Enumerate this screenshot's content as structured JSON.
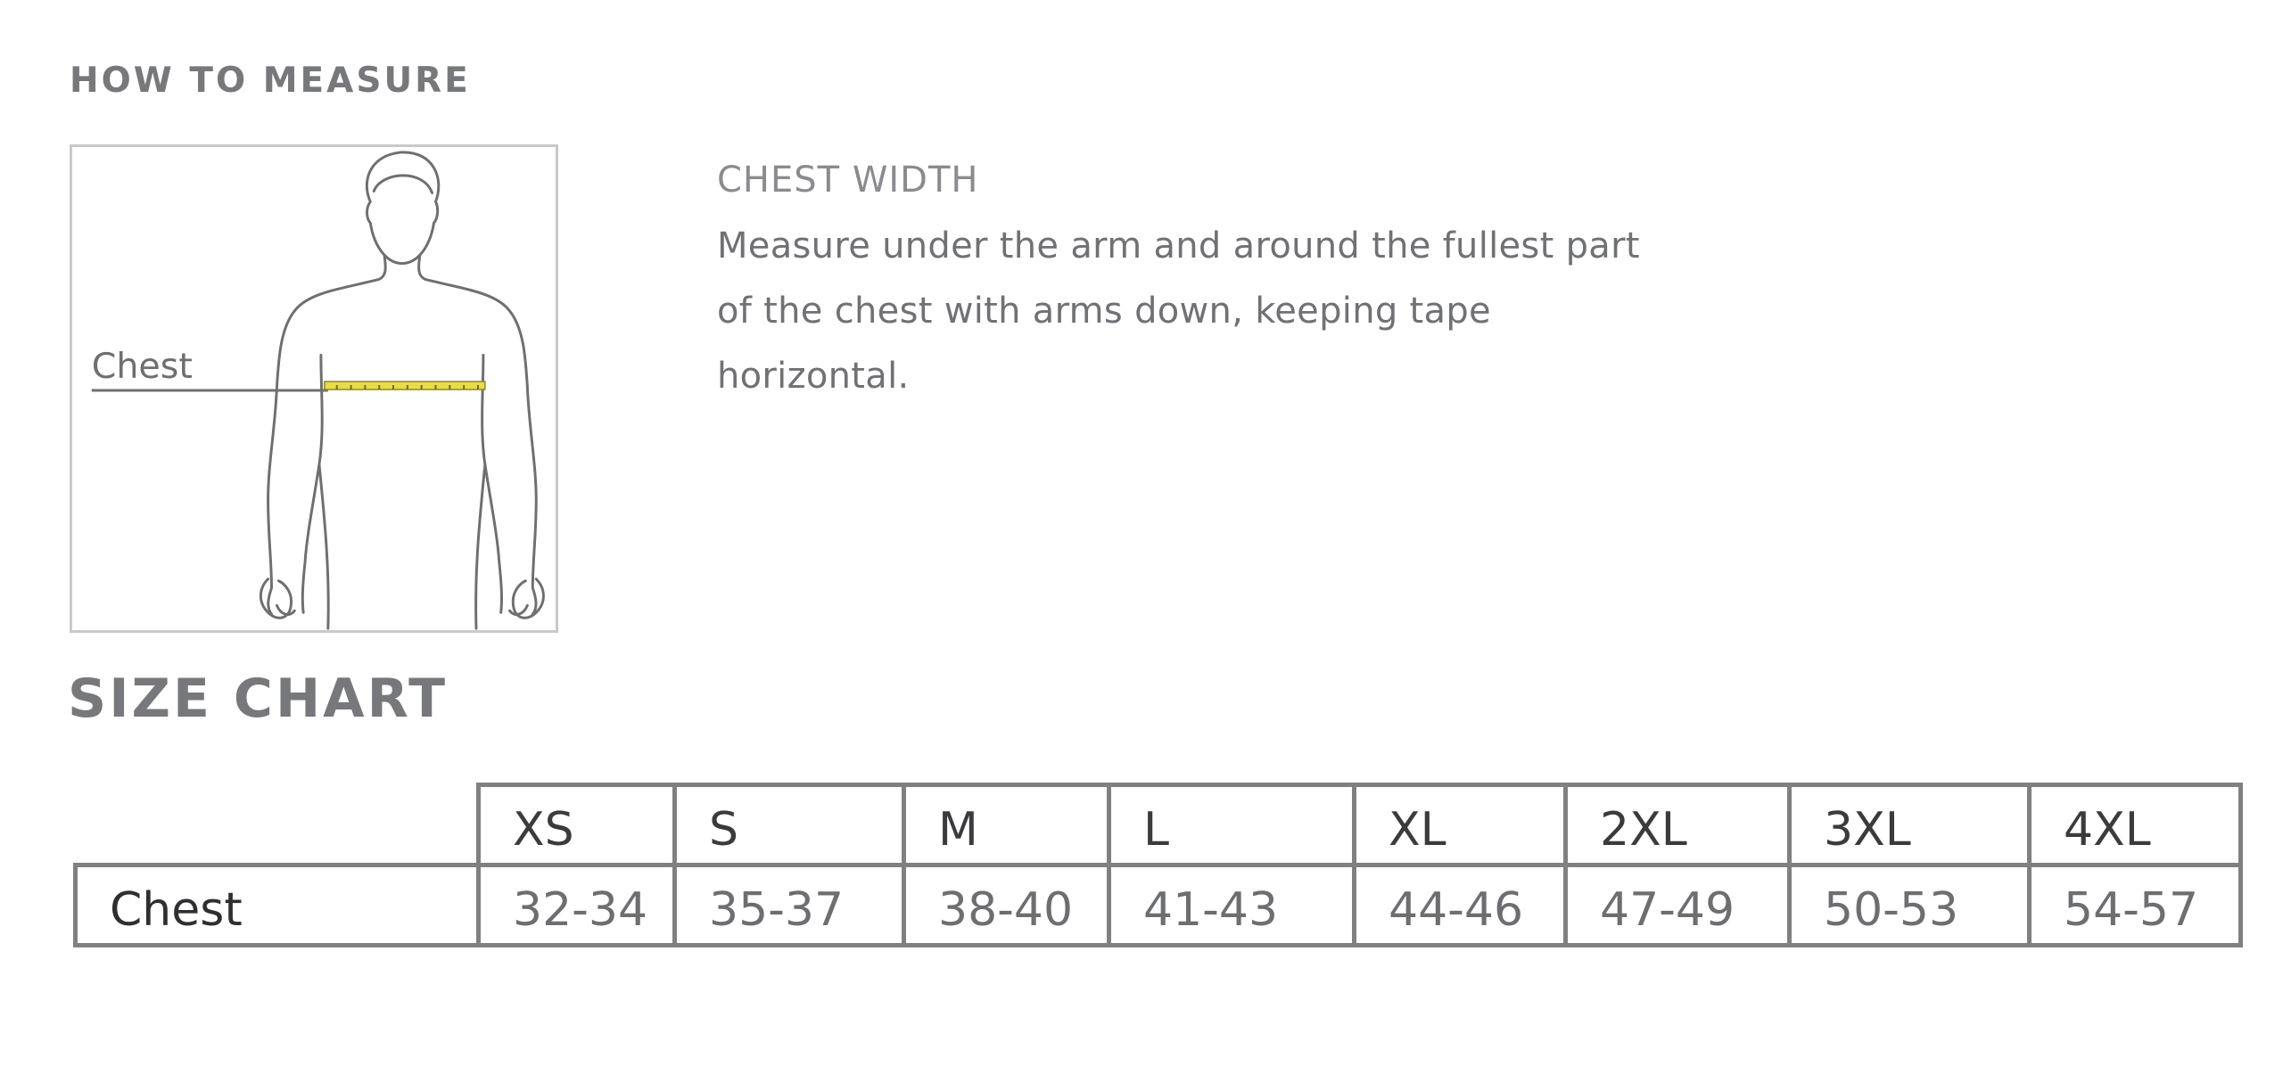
{
  "how_to_measure": {
    "title": "HOW TO MEASURE",
    "figure_label": "Chest",
    "figure_icon": "body-silhouette-chest-tape-icon",
    "tape_color": "#e8dc4a",
    "heading": "CHEST WIDTH",
    "description": "Measure under the arm and around the fullest part of the chest with arms down, keeping tape horizontal."
  },
  "size_chart": {
    "title": "SIZE CHART",
    "sizes": [
      "XS",
      "S",
      "M",
      "L",
      "XL",
      "2XL",
      "3XL",
      "4XL"
    ],
    "rows": [
      {
        "label": "Chest",
        "values": [
          "32-34",
          "35-37",
          "38-40",
          "41-43",
          "44-46",
          "47-49",
          "50-53",
          "54-57"
        ]
      }
    ]
  }
}
